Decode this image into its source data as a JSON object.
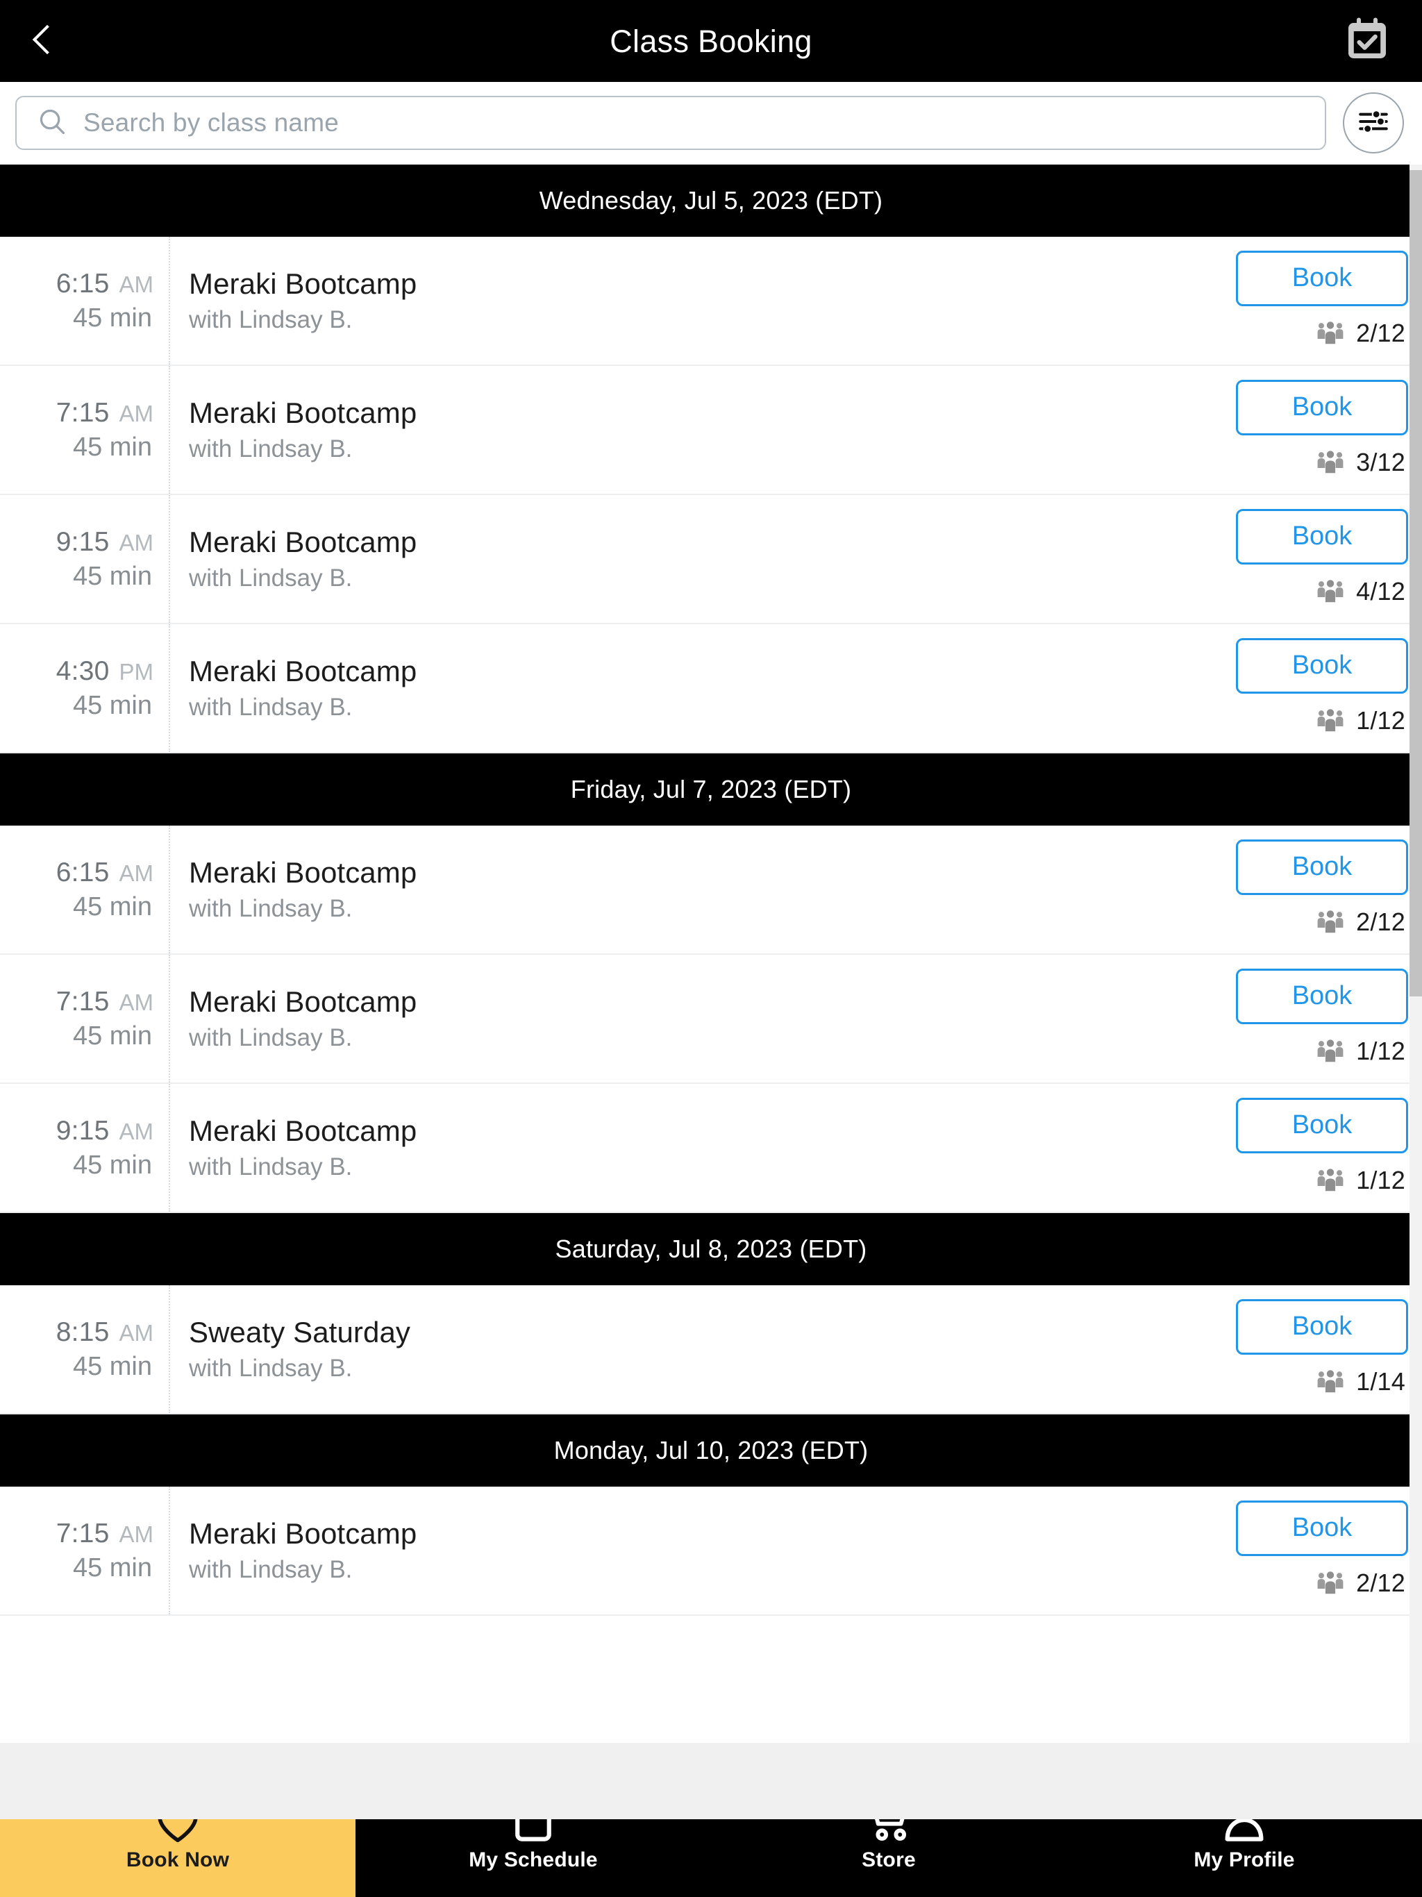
{
  "header": {
    "back_icon": "chevron-left-icon",
    "title": "Class Booking",
    "calendar_icon": "calendar-check-icon"
  },
  "search": {
    "icon": "search-icon",
    "placeholder": "Search by class name",
    "value": "",
    "filter_icon": "sliders-filter-icon"
  },
  "colors": {
    "accent_blue": "#2196e8",
    "active_nav": "#fbcb5d",
    "header_bg": "#000000",
    "muted_text": "#8d9297"
  },
  "labels": {
    "book": "Book",
    "capacity_icon": "people-group-icon"
  },
  "days": [
    {
      "date_label": "Wednesday, Jul 5, 2023 (EDT)",
      "classes": [
        {
          "time": "6:15",
          "meridiem": "AM",
          "duration": "45 min",
          "name": "Meraki Bootcamp",
          "instructor": "with Lindsay B.",
          "book_label": "Book",
          "capacity": "2/12"
        },
        {
          "time": "7:15",
          "meridiem": "AM",
          "duration": "45 min",
          "name": "Meraki Bootcamp",
          "instructor": "with Lindsay B.",
          "book_label": "Book",
          "capacity": "3/12"
        },
        {
          "time": "9:15",
          "meridiem": "AM",
          "duration": "45 min",
          "name": "Meraki Bootcamp",
          "instructor": "with Lindsay B.",
          "book_label": "Book",
          "capacity": "4/12"
        },
        {
          "time": "4:30",
          "meridiem": "PM",
          "duration": "45 min",
          "name": "Meraki Bootcamp",
          "instructor": "with Lindsay B.",
          "book_label": "Book",
          "capacity": "1/12"
        }
      ]
    },
    {
      "date_label": "Friday, Jul 7, 2023 (EDT)",
      "classes": [
        {
          "time": "6:15",
          "meridiem": "AM",
          "duration": "45 min",
          "name": "Meraki Bootcamp",
          "instructor": "with Lindsay B.",
          "book_label": "Book",
          "capacity": "2/12"
        },
        {
          "time": "7:15",
          "meridiem": "AM",
          "duration": "45 min",
          "name": "Meraki Bootcamp",
          "instructor": "with Lindsay B.",
          "book_label": "Book",
          "capacity": "1/12"
        },
        {
          "time": "9:15",
          "meridiem": "AM",
          "duration": "45 min",
          "name": "Meraki Bootcamp",
          "instructor": "with Lindsay B.",
          "book_label": "Book",
          "capacity": "1/12"
        }
      ]
    },
    {
      "date_label": "Saturday, Jul 8, 2023 (EDT)",
      "classes": [
        {
          "time": "8:15",
          "meridiem": "AM",
          "duration": "45 min",
          "name": "Sweaty Saturday",
          "instructor": "with Lindsay B.",
          "book_label": "Book",
          "capacity": "1/14"
        }
      ]
    },
    {
      "date_label": "Monday, Jul 10, 2023 (EDT)",
      "classes": [
        {
          "time": "7:15",
          "meridiem": "AM",
          "duration": "45 min",
          "name": "Meraki Bootcamp",
          "instructor": "with Lindsay B.",
          "book_label": "Book",
          "capacity": "2/12"
        }
      ]
    }
  ],
  "bottom_nav": {
    "items": [
      {
        "label": "Book Now",
        "icon": "heart-outline-icon",
        "active": true
      },
      {
        "label": "My Schedule",
        "icon": "calendar-outline-icon",
        "active": false
      },
      {
        "label": "Store",
        "icon": "shopping-cart-icon",
        "active": false
      },
      {
        "label": "My Profile",
        "icon": "person-head-icon",
        "active": false
      }
    ]
  }
}
